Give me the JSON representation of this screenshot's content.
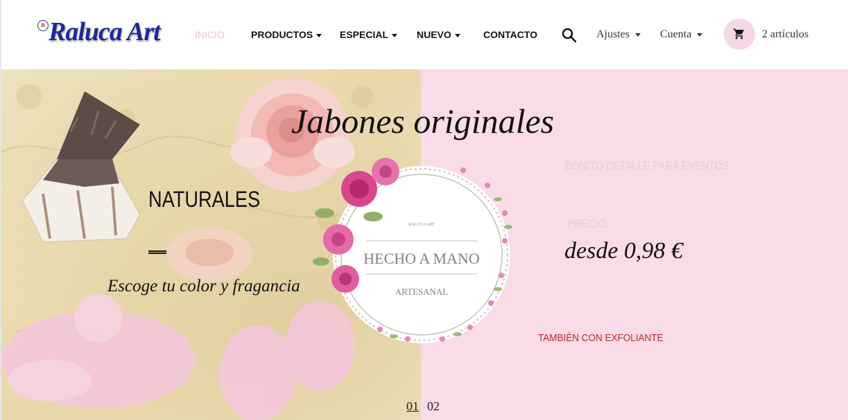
{
  "header": {
    "logo": "Raluca Art",
    "logo_mark": "R",
    "nav": [
      {
        "label": "INICIO",
        "active": true,
        "has_dropdown": false
      },
      {
        "label": "PRODUCTOS",
        "active": false,
        "has_dropdown": true
      },
      {
        "label": "ESPECIAL",
        "active": false,
        "has_dropdown": true
      },
      {
        "label": "NUEVO",
        "active": false,
        "has_dropdown": true
      },
      {
        "label": "CONTACTO",
        "active": false,
        "has_dropdown": false
      }
    ],
    "settings_label": "Ajustes",
    "account_label": "Cuenta",
    "cart_count": "2 artículos",
    "icons": {
      "search": "search-icon",
      "cart": "cart-icon"
    }
  },
  "hero": {
    "title": "Jabones originales",
    "left": {
      "heading": "NATURALES",
      "tagline": "Escoge tu color y fragancia"
    },
    "right": {
      "event_label": "BONITO DETALLE PARA EVENTOS",
      "price_label": "PRECIO",
      "price": "desde 0,98 €",
      "exfoliante": "TAMBIÉN CON EXFOLIANTE"
    },
    "badge": {
      "small_text": "RALUCA ART",
      "main_text": "HECHO A MANO",
      "bottom_text": "ARTESANAL"
    },
    "pager": [
      {
        "label": "01",
        "active": true
      },
      {
        "label": "02",
        "active": false
      }
    ]
  },
  "colors": {
    "accent_pink": "#f6d7e6",
    "right_panel": "#fadce9",
    "logo_blue": "#1c2a9a",
    "active_nav": "#f0bcd6",
    "exfoliante_red": "#b52a2a"
  }
}
